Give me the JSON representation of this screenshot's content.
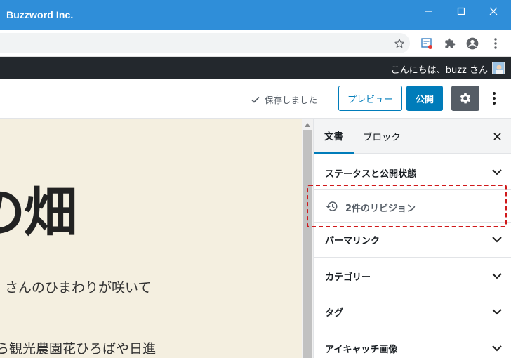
{
  "browser": {
    "window_title": "Buzzword Inc.",
    "icons": [
      "minimize-icon",
      "maximize-icon",
      "close-icon",
      "star-icon",
      "extension-translate-icon",
      "puzzle-icon",
      "account-icon",
      "menu-dots-icon"
    ]
  },
  "adminbar": {
    "greeting": "こんにちは、buzz さん"
  },
  "editor_header": {
    "saved_label": "保存しました",
    "preview_label": "プレビュー",
    "publish_label": "公開"
  },
  "content": {
    "title_fragment": "の畑",
    "paragraph1": "さんのひまわりが咲いて",
    "paragraph2": "ら観光農園花ひろばや日進"
  },
  "sidebar": {
    "tabs": [
      {
        "label": "文書"
      },
      {
        "label": "ブロック"
      }
    ],
    "panels": [
      {
        "label": "ステータスと公開状態"
      },
      {
        "label": "パーマリンク"
      },
      {
        "label": "カテゴリー"
      },
      {
        "label": "タグ"
      },
      {
        "label": "アイキャッチ画像"
      }
    ],
    "revisions_label": "2件のリビジョン"
  },
  "colors": {
    "titlebar": "#2f8ed9",
    "adminbar": "#23282d",
    "accent": "#007cba",
    "highlight": "#d0191b"
  }
}
